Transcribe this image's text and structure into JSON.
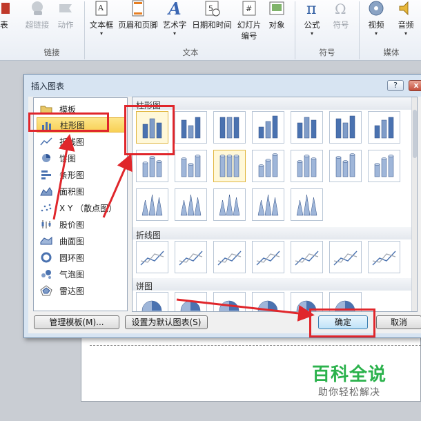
{
  "ribbon": {
    "buttons": [
      {
        "label": "表",
        "icon": "table-icon"
      },
      {
        "label": "超链接",
        "icon": "hyperlink-icon",
        "disabled": true
      },
      {
        "label": "动作",
        "icon": "action-icon",
        "disabled": true
      },
      {
        "label": "文本框",
        "icon": "textbox-icon"
      },
      {
        "label": "页眉和页脚",
        "icon": "header-footer-icon"
      },
      {
        "label": "艺术字",
        "icon": "wordart-icon"
      },
      {
        "label": "日期和时间",
        "icon": "date-time-icon"
      },
      {
        "label": "幻灯片编号",
        "line1": "幻灯片",
        "line2": "编号",
        "icon": "slide-number-icon"
      },
      {
        "label": "对象",
        "icon": "object-icon"
      },
      {
        "label": "公式",
        "icon": "equation-icon"
      },
      {
        "label": "符号",
        "icon": "symbol-icon",
        "disabled": true
      },
      {
        "label": "视频",
        "icon": "video-icon"
      },
      {
        "label": "音频",
        "icon": "audio-icon"
      }
    ],
    "groups": {
      "links": "链接",
      "text": "文本",
      "symbols": "符号",
      "media": "媒体"
    }
  },
  "dialog": {
    "title": "插入图表",
    "help": "?",
    "close": "x",
    "categories": [
      {
        "label": "模板",
        "icon": "folder-icon"
      },
      {
        "label": "柱形图",
        "icon": "column-chart-icon",
        "selected": true
      },
      {
        "label": "折线图",
        "icon": "line-chart-icon"
      },
      {
        "label": "饼图",
        "icon": "pie-chart-icon"
      },
      {
        "label": "条形图",
        "icon": "bar-chart-icon"
      },
      {
        "label": "面积图",
        "icon": "area-chart-icon"
      },
      {
        "label": "X Y （散点图）",
        "icon": "scatter-chart-icon"
      },
      {
        "label": "股价图",
        "icon": "stock-chart-icon"
      },
      {
        "label": "曲面图",
        "icon": "surface-chart-icon"
      },
      {
        "label": "圆环图",
        "icon": "doughnut-chart-icon"
      },
      {
        "label": "气泡图",
        "icon": "bubble-chart-icon"
      },
      {
        "label": "雷达图",
        "icon": "radar-chart-icon"
      }
    ],
    "sections": {
      "column": "柱形图",
      "line": "折线图",
      "pie": "饼图"
    },
    "buttons": {
      "manage_templates": "管理模板(M)...",
      "set_default": "设置为默认图表(S)",
      "ok": "确定",
      "cancel": "取消"
    }
  },
  "watermark": {
    "title": "百科全说",
    "subtitle": "助你轻松解决"
  },
  "colors": {
    "annotation": "#e0262b",
    "selection": "#f8d055",
    "watermark": "#2bb24c"
  }
}
